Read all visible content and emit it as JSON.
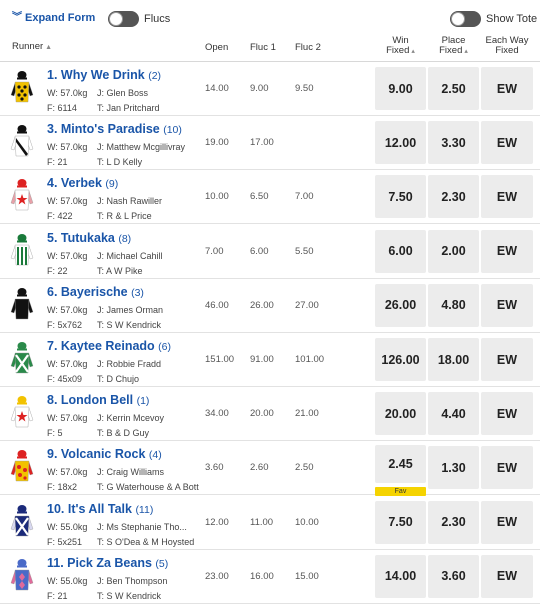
{
  "topbar": {
    "expand_label": "Expand Form",
    "flucs_label": "Flucs",
    "show_tote_label": "Show Tote"
  },
  "headers": {
    "runner": "Runner",
    "open": "Open",
    "fluc1": "Fluc 1",
    "fluc2": "Fluc 2",
    "win_l1": "Win",
    "win_l2": "Fixed",
    "place_l1": "Place",
    "place_l2": "Fixed",
    "ew_l1": "Each Way",
    "ew_l2": "Fixed"
  },
  "runners": [
    {
      "name": "1. Why We Drink",
      "barrier": "(2)",
      "weight": "W: 57.0kg",
      "jockey": "J: Glen Boss",
      "form": "F: 6114",
      "trainer": "T: Jan Pritchard",
      "open": "14.00",
      "fluc1": "9.00",
      "fluc2": "9.50",
      "win": "9.00",
      "place": "2.50",
      "ew": "EW",
      "silk": {
        "body": "#f2c200",
        "pattern": "dots",
        "pat": "#111",
        "sleeve": "#111",
        "cap": "#111"
      }
    },
    {
      "name": "3. Minto's Paradise",
      "barrier": "(10)",
      "weight": "W: 57.0kg",
      "jockey": "J: Matthew Mcgillivray",
      "form": "F: 21",
      "trainer": "T: L D Kelly",
      "open": "19.00",
      "fluc1": "17.00",
      "fluc2": "",
      "win": "12.00",
      "place": "3.30",
      "ew": "EW",
      "silk": {
        "body": "#ffffff",
        "pattern": "sash",
        "pat": "#111",
        "sleeve": "#ffffff",
        "cap": "#111"
      }
    },
    {
      "name": "4. Verbek",
      "barrier": "(9)",
      "weight": "W: 57.0kg",
      "jockey": "J: Nash Rawiller",
      "form": "F: 422",
      "trainer": "T: R & L Price",
      "open": "10.00",
      "fluc1": "6.50",
      "fluc2": "7.00",
      "win": "7.50",
      "place": "2.30",
      "ew": "EW",
      "silk": {
        "body": "#ffffff",
        "pattern": "star",
        "pat": "#d22",
        "sleeve": "#e8a0a8",
        "cap": "#d22"
      }
    },
    {
      "name": "5. Tutukaka",
      "barrier": "(8)",
      "weight": "W: 57.0kg",
      "jockey": "J: Michael Cahill",
      "form": "F: 22",
      "trainer": "T: A W Pike",
      "open": "7.00",
      "fluc1": "6.00",
      "fluc2": "5.50",
      "win": "6.00",
      "place": "2.00",
      "ew": "EW",
      "silk": {
        "body": "#ffffff",
        "pattern": "stripes",
        "pat": "#1a7a3a",
        "sleeve": "#ffffff",
        "cap": "#1a7a3a"
      }
    },
    {
      "name": "6. Bayerische",
      "barrier": "(3)",
      "weight": "W: 57.0kg",
      "jockey": "J: James Orman",
      "form": "F: 5x762",
      "trainer": "T: S W Kendrick",
      "open": "46.00",
      "fluc1": "26.00",
      "fluc2": "27.00",
      "win": "26.00",
      "place": "4.80",
      "ew": "EW",
      "silk": {
        "body": "#111111",
        "pattern": "none",
        "pat": "#111",
        "sleeve": "#111111",
        "cap": "#111"
      }
    },
    {
      "name": "7. Kaytee Reinado",
      "barrier": "(6)",
      "weight": "W: 57.0kg",
      "jockey": "J: Robbie Fradd",
      "form": "F: 45x09",
      "trainer": "T: D Chujo",
      "open": "151.00",
      "fluc1": "91.00",
      "fluc2": "101.00",
      "win": "126.00",
      "place": "18.00",
      "ew": "EW",
      "silk": {
        "body": "#2a8a4a",
        "pattern": "cross",
        "pat": "#ffffff",
        "sleeve": "#2a8a4a",
        "cap": "#2a8a4a"
      }
    },
    {
      "name": "8. London Bell",
      "barrier": "(1)",
      "weight": "W: 57.0kg",
      "jockey": "J: Kerrin Mcevoy",
      "form": "F: 5",
      "trainer": "T: B & D Guy",
      "open": "34.00",
      "fluc1": "20.00",
      "fluc2": "21.00",
      "win": "20.00",
      "place": "4.40",
      "ew": "EW",
      "silk": {
        "body": "#ffffff",
        "pattern": "star",
        "pat": "#d22",
        "sleeve": "#ffffff",
        "cap": "#f2c200"
      }
    },
    {
      "name": "9. Volcanic Rock",
      "barrier": "(4)",
      "weight": "W: 57.0kg",
      "jockey": "J: Craig Williams",
      "form": "F: 18x2",
      "trainer": "T: G Waterhouse & A Bott",
      "open": "3.60",
      "fluc1": "2.60",
      "fluc2": "2.50",
      "win": "2.45",
      "place": "1.30",
      "ew": "EW",
      "fav": "Fav",
      "silk": {
        "body": "#f2c200",
        "pattern": "spots",
        "pat": "#d22",
        "sleeve": "#d22",
        "cap": "#d22"
      }
    },
    {
      "name": "10. It's All Talk",
      "barrier": "(11)",
      "weight": "W: 55.0kg",
      "jockey": "J: Ms Stephanie Tho...",
      "form": "F: 5x251",
      "trainer": "T: S O'Dea & M Hoysted",
      "open": "12.00",
      "fluc1": "11.00",
      "fluc2": "10.00",
      "win": "7.50",
      "place": "2.30",
      "ew": "EW",
      "silk": {
        "body": "#1b2a7a",
        "pattern": "cross",
        "pat": "#ffffff",
        "sleeve": "#d8d8f0",
        "cap": "#1b2a7a"
      }
    },
    {
      "name": "11. Pick Za Beans",
      "barrier": "(5)",
      "weight": "W: 55.0kg",
      "jockey": "J: Ben Thompson",
      "form": "F: 21",
      "trainer": "T: S W Kendrick",
      "open": "23.00",
      "fluc1": "16.00",
      "fluc2": "15.00",
      "win": "14.00",
      "place": "3.60",
      "ew": "EW",
      "silk": {
        "body": "#4a6ac8",
        "pattern": "diamonds",
        "pat": "#e06a9a",
        "sleeve": "#e06a9a",
        "cap": "#4a6ac8"
      }
    }
  ]
}
